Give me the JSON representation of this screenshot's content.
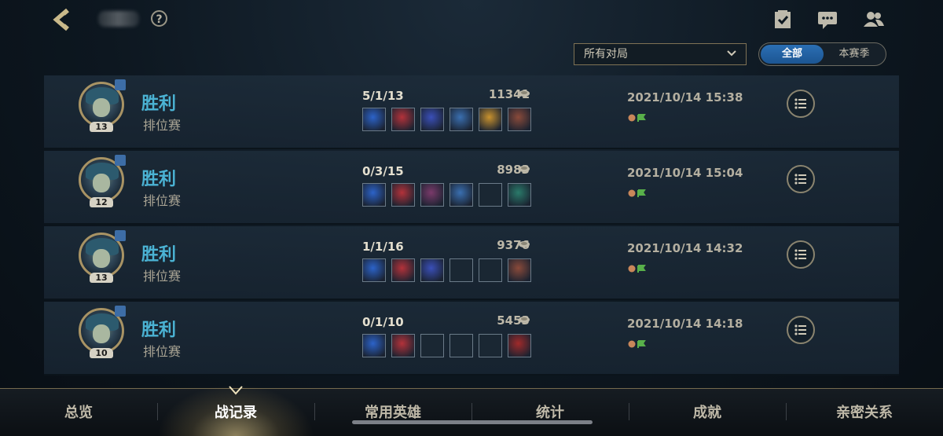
{
  "header": {
    "help_label": "?"
  },
  "filter": {
    "selected": "所有对局",
    "segments": [
      "全部",
      "本赛季"
    ],
    "active_segment": "全部"
  },
  "matches": [
    {
      "level": "13",
      "result": "胜利",
      "mode": "排位赛",
      "kda": "5/1/13",
      "gold": "11341",
      "date": "2021/10/14 15:38",
      "items": [
        "#2c63c9",
        "#b3323a",
        "#3a4fb8",
        "#3a6fb0",
        "#c9922e",
        "#8a4a3a"
      ]
    },
    {
      "level": "12",
      "result": "胜利",
      "mode": "排位赛",
      "kda": "0/3/15",
      "gold": "8983",
      "date": "2021/10/14 15:04",
      "items": [
        "#2c63c9",
        "#b3323a",
        "#7a3a6a",
        "#3a6fb0",
        "",
        "#2a7a6a"
      ]
    },
    {
      "level": "13",
      "result": "胜利",
      "mode": "排位赛",
      "kda": "1/1/16",
      "gold": "9376",
      "date": "2021/10/14 14:32",
      "items": [
        "#2c63c9",
        "#b3323a",
        "#3a4fb8",
        "",
        "",
        "#8a4a3a"
      ]
    },
    {
      "level": "10",
      "result": "胜利",
      "mode": "排位赛",
      "kda": "0/1/10",
      "gold": "5453",
      "date": "2021/10/14 14:18",
      "items": [
        "#2c63c9",
        "#b3323a",
        "",
        "",
        "",
        "#a02a2a"
      ]
    }
  ],
  "nav": {
    "items": [
      "总览",
      "战记录",
      "常用英雄",
      "统计",
      "成就",
      "亲密关系"
    ],
    "active": "战记录"
  },
  "colors": {
    "win": "#4bb3d4",
    "accent_gold": "#a89364",
    "segment_active": "#2b6fb4"
  },
  "icons": [
    "back-arrow-icon",
    "help-icon",
    "task-icon",
    "chat-icon",
    "friends-icon",
    "chevron-down-icon",
    "gold-coin-icon",
    "list-icon"
  ]
}
